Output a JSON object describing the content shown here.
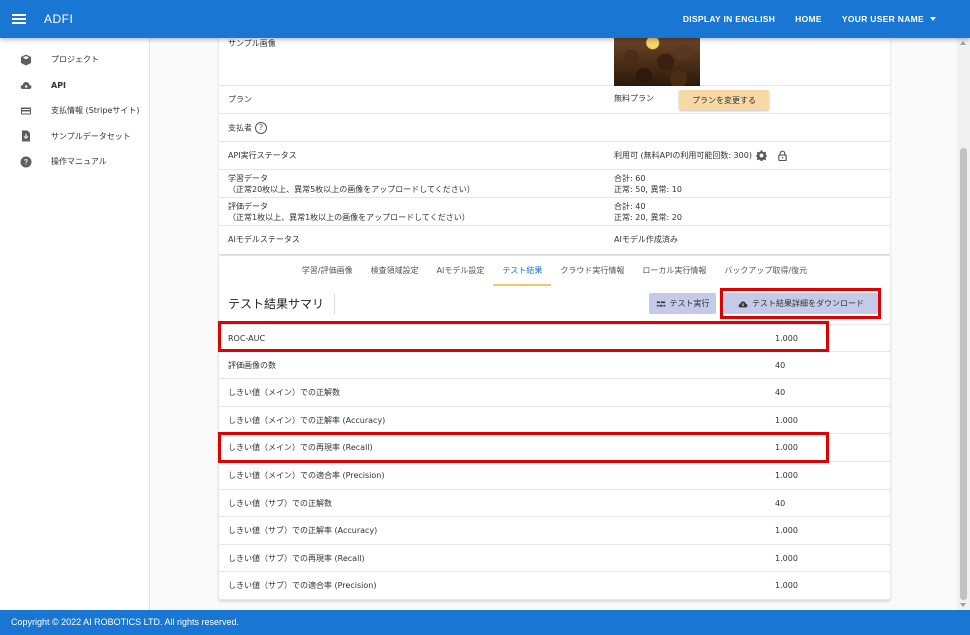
{
  "appbar": {
    "title": "ADFI",
    "nav": {
      "english": "DISPLAY IN ENGLISH",
      "home": "HOME",
      "user": "YOUR USER NAME"
    }
  },
  "sidebar": {
    "items": [
      {
        "label": "プロジェクト",
        "icon": "cube-icon"
      },
      {
        "label": "API",
        "icon": "cloud-gear-icon"
      },
      {
        "label": "支払情報 (Stripeサイト)",
        "icon": "credit-card-icon"
      },
      {
        "label": "サンプルデータセット",
        "icon": "download-file-icon"
      },
      {
        "label": "操作マニュアル",
        "icon": "help-icon"
      }
    ]
  },
  "project": {
    "sample_image_label": "サンプル画像",
    "plan_label": "プラン",
    "plan_value": "無料プラン",
    "plan_change_button": "プランを変更する",
    "payer_label": "支払者",
    "api_status_label": "API実行ステータス",
    "api_status_value": "利用可 (無料APIの利用可能回数: 300)",
    "train_label_1": "学習データ",
    "train_label_2": "（正常20枚以上、異常5枚以上の画像をアップロードしてください）",
    "train_value_1": "合計: 60",
    "train_value_2": "正常: 50, 異常: 10",
    "eval_label_1": "評価データ",
    "eval_label_2": "（正常1枚以上、異常1枚以上の画像をアップロードしてください）",
    "eval_value_1": "合計: 40",
    "eval_value_2": "正常: 20, 異常: 20",
    "model_status_label": "AIモデルステータス",
    "model_status_value": "AIモデル作成済み"
  },
  "tabs": [
    {
      "label": "学習/評価画像",
      "active": false
    },
    {
      "label": "検査領域設定",
      "active": false
    },
    {
      "label": "AIモデル設定",
      "active": false
    },
    {
      "label": "テスト結果",
      "active": true
    },
    {
      "label": "クラウド実行情報",
      "active": false
    },
    {
      "label": "ローカル実行情報",
      "active": false
    },
    {
      "label": "バックアップ取得/復元",
      "active": false
    }
  ],
  "summary": {
    "title": "テスト結果サマリ",
    "test_button": "テスト実行",
    "download_button": "テスト結果詳細をダウンロード"
  },
  "metrics": [
    {
      "label": "ROC-AUC",
      "value": "1.000"
    },
    {
      "label": "評価画像の数",
      "value": "40"
    },
    {
      "label": "しきい値（メイン）での正解数",
      "value": "40"
    },
    {
      "label": "しきい値（メイン）での正解率 (Accuracy)",
      "value": "1.000"
    },
    {
      "label": "しきい値（メイン）での再現率 (Recall)",
      "value": "1.000"
    },
    {
      "label": "しきい値（メイン）での適合率 (Precision)",
      "value": "1.000"
    },
    {
      "label": "しきい値（サブ）での正解数",
      "value": "40"
    },
    {
      "label": "しきい値（サブ）での正解率 (Accuracy)",
      "value": "1.000"
    },
    {
      "label": "しきい値（サブ）での再現率 (Recall)",
      "value": "1.000"
    },
    {
      "label": "しきい値（サブ）での適合率 (Precision)",
      "value": "1.000"
    }
  ],
  "footer": "Copyright © 2022 AI ROBOTICS LTD. All rights reserved.",
  "colors": {
    "primary": "#1976d2",
    "highlight": "#e00000",
    "plan_button": "#f8d9a6",
    "action_button": "#c5cae9",
    "tab_indicator": "#f5c56b"
  }
}
